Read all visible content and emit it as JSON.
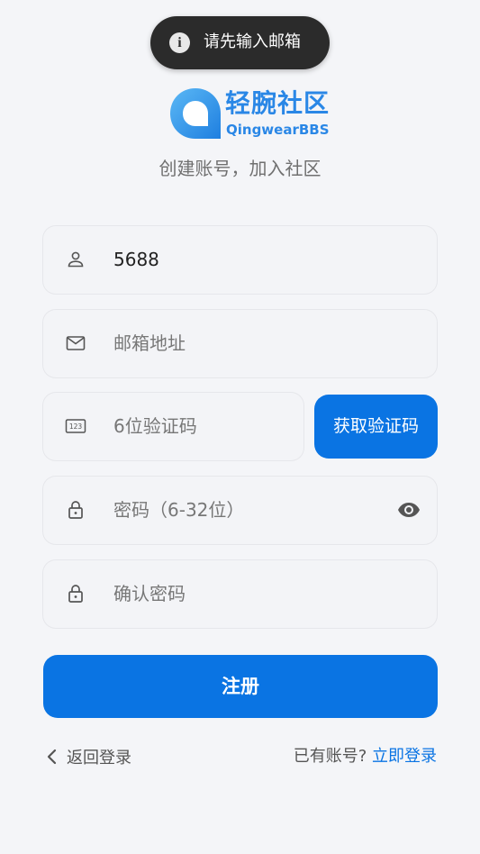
{
  "toast": {
    "icon": "info-icon",
    "message": "请先输入邮箱"
  },
  "brand": {
    "name_cn": "轻腕社区",
    "name_en": "QingwearBBS",
    "color": "#2a87e6"
  },
  "subtitle": "创建账号，加入社区",
  "form": {
    "username": {
      "icon": "user-icon",
      "value": "5688"
    },
    "email": {
      "icon": "mail-icon",
      "placeholder": "邮箱地址"
    },
    "code": {
      "icon": "keypad-icon",
      "placeholder": "6位验证码",
      "button": "获取验证码"
    },
    "password": {
      "icon": "lock-icon",
      "placeholder": "密码（6-32位）",
      "toggle_icon": "eye-icon"
    },
    "confirm": {
      "icon": "lock-icon",
      "placeholder": "确认密码"
    },
    "submit": "注册"
  },
  "footer": {
    "back": "返回登录",
    "back_icon": "chevron-left-icon",
    "have_account": "已有账号?",
    "login_now": "立即登录"
  },
  "colors": {
    "accent": "#0a74e3",
    "background": "#f4f5f8"
  }
}
